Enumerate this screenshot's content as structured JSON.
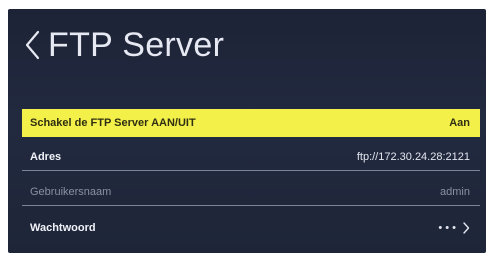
{
  "header": {
    "title": "FTP Server",
    "back_icon": "chevron-left-icon"
  },
  "settings": [
    {
      "label": "Schakel de FTP Server AAN/UIT",
      "value": "Aan"
    },
    {
      "label": "Adres",
      "value": "ftp://172.30.24.28:2121"
    },
    {
      "label": "Gebruikersnaam",
      "value": "admin"
    },
    {
      "label": "Wachtwoord",
      "value": "• • •",
      "icon": "chevron-right-icon"
    }
  ],
  "colors": {
    "highlight": "#f4f04a",
    "panel": "#1f2538"
  }
}
